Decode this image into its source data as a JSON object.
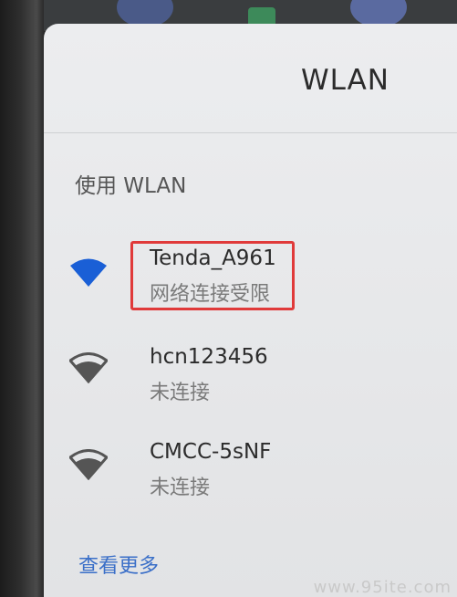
{
  "header": {
    "title": "WLAN"
  },
  "section": {
    "label": "使用 WLAN"
  },
  "networks": [
    {
      "ssid": "Tenda_A961",
      "status": "网络连接受限",
      "icon": "wifi-full-icon",
      "color": "#1a5fd6"
    },
    {
      "ssid": "hcn123456",
      "status": "未连接",
      "icon": "wifi-strong-icon",
      "color": "#555555"
    },
    {
      "ssid": "CMCC-5sNF",
      "status": "未连接",
      "icon": "wifi-strong-icon",
      "color": "#555555"
    }
  ],
  "footer": {
    "more_label": "查看更多"
  },
  "watermark": "www.95ite.com"
}
